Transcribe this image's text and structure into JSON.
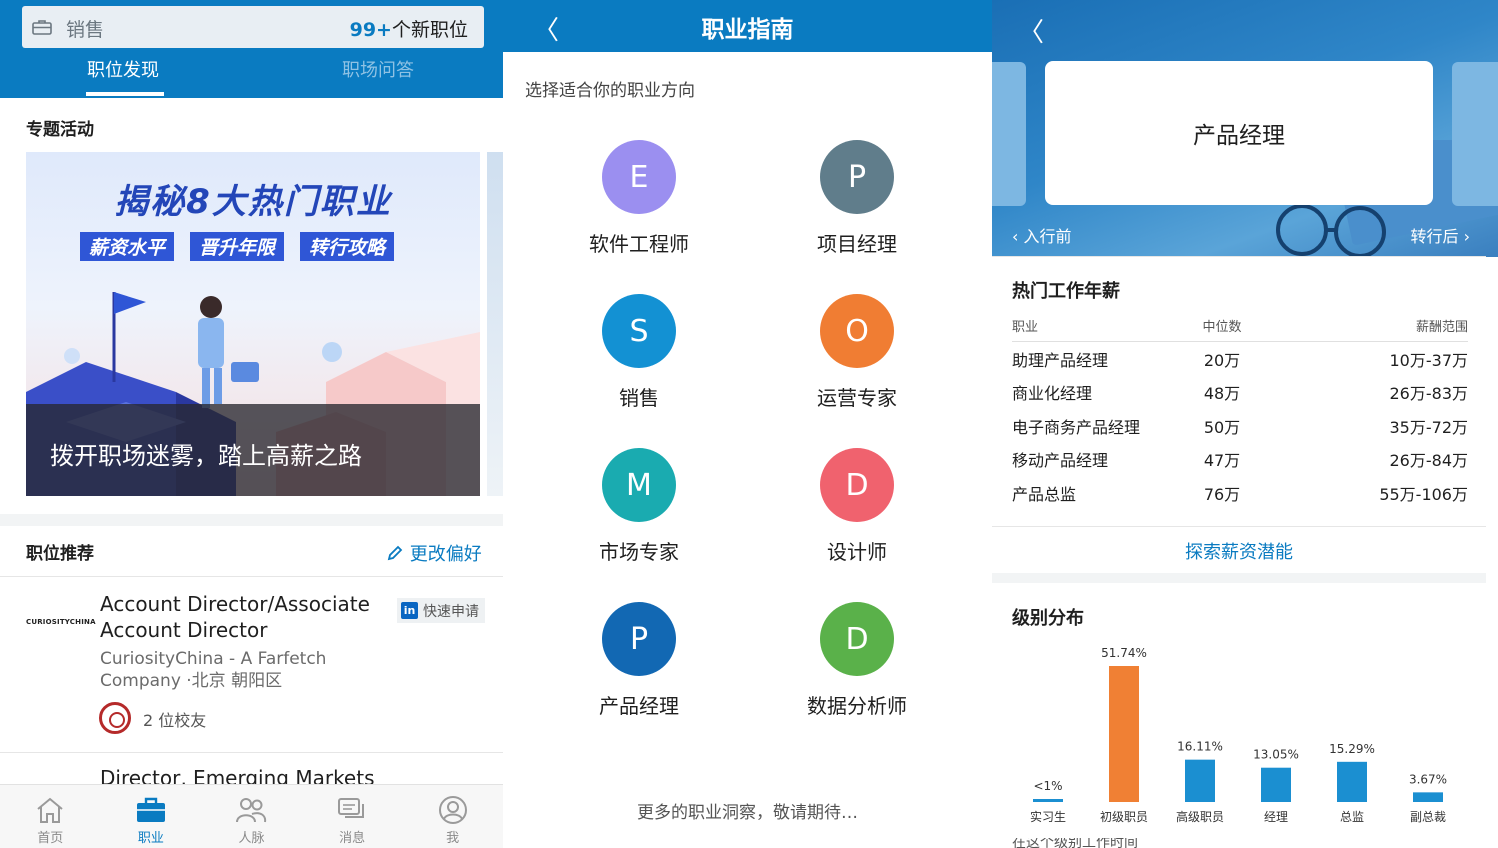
{
  "panel1": {
    "search": {
      "query": "销售",
      "count_highlight": "99+",
      "count_suffix": "个新职位",
      "icon": "briefcase-icon"
    },
    "tabs": [
      {
        "label": "职位发现",
        "active": true
      },
      {
        "label": "职场问答",
        "active": false
      }
    ],
    "featured": {
      "title": "专题活动",
      "banner_title": "揭秘8大热门职业",
      "banner_tags": [
        "薪资水平",
        "晋升年限",
        "转行攻略"
      ],
      "banner_caption": "拨开职场迷雾，踏上高薪之路"
    },
    "recommend": {
      "title": "职位推荐",
      "edit_label": "更改偏好",
      "jobs": [
        {
          "company_logo_text": "CURIOSITYCHINA",
          "title": "Account Director/Associate Account Director",
          "quick_apply": "快速申请",
          "company": "CuriosityChina - A Farfetch Company",
          "location": "·北京 朝阳区",
          "alumni": "2 位校友"
        },
        {
          "title": "Director, Emerging Markets"
        }
      ]
    },
    "bottom_nav": [
      {
        "label": "首页",
        "icon": "home-icon",
        "active": false
      },
      {
        "label": "职业",
        "icon": "briefcase-icon",
        "active": true
      },
      {
        "label": "人脉",
        "icon": "people-icon",
        "active": false
      },
      {
        "label": "消息",
        "icon": "messages-icon",
        "active": false
      },
      {
        "label": "我",
        "icon": "profile-icon",
        "active": false
      }
    ]
  },
  "panel2": {
    "title": "职业指南",
    "subtitle": "选择适合你的职业方向",
    "careers": [
      {
        "letter": "E",
        "label": "软件工程师",
        "color": "#9b8ff0"
      },
      {
        "letter": "P",
        "label": "项目经理",
        "color": "#607d8b"
      },
      {
        "letter": "S",
        "label": "销售",
        "color": "#1391d3"
      },
      {
        "letter": "O",
        "label": "运营专家",
        "color": "#f07d33"
      },
      {
        "letter": "M",
        "label": "市场专家",
        "color": "#1aabb0"
      },
      {
        "letter": "D",
        "label": "设计师",
        "color": "#f0626e"
      },
      {
        "letter": "P",
        "label": "产品经理",
        "color": "#1268b3"
      },
      {
        "letter": "D",
        "label": "数据分析师",
        "color": "#5ab14a"
      }
    ],
    "footer": "更多的职业洞察，敬请期待…"
  },
  "panel3": {
    "career_title": "产品经理",
    "prev_label": "入行前",
    "next_label": "转行后",
    "salary": {
      "title": "热门工作年薪",
      "headers": [
        "职业",
        "中位数",
        "薪酬范围"
      ],
      "rows": [
        [
          "助理产品经理",
          "20万",
          "10万-37万"
        ],
        [
          "商业化经理",
          "48万",
          "26万-83万"
        ],
        [
          "电子商务产品经理",
          "50万",
          "35万-72万"
        ],
        [
          "移动产品经理",
          "47万",
          "26万-84万"
        ],
        [
          "产品总监",
          "76万",
          "55万-106万"
        ]
      ],
      "explore_label": "探索薪资潜能"
    },
    "distribution_title": "级别分布",
    "bottom_hint": "在这个级别工作时间"
  },
  "chart_data": {
    "type": "bar",
    "title": "级别分布",
    "categories": [
      "实习生",
      "初级职员",
      "高级职员",
      "经理",
      "总监",
      "副总裁"
    ],
    "values": [
      0.5,
      51.74,
      16.11,
      13.05,
      15.29,
      3.67
    ],
    "value_labels": [
      "<1%",
      "51.74%",
      "16.11%",
      "13.05%",
      "15.29%",
      "3.67%"
    ],
    "colors": [
      "#1b8fd1",
      "#f08034",
      "#1b8fd1",
      "#1b8fd1",
      "#1b8fd1",
      "#1b8fd1"
    ],
    "ylim": [
      0,
      51.74
    ],
    "grid": false
  }
}
